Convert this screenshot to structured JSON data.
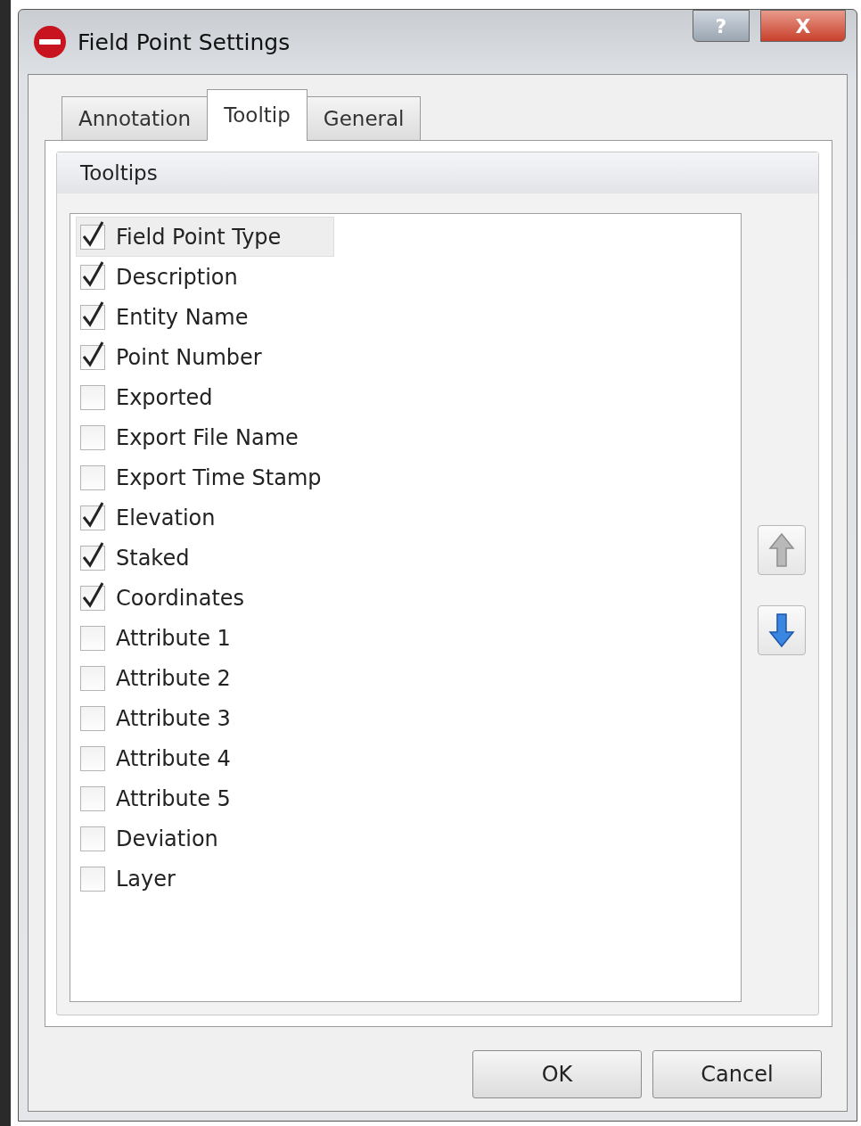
{
  "window": {
    "title": "Field Point Settings",
    "help": "?",
    "close": "X"
  },
  "tabs": [
    {
      "label": "Annotation",
      "selected": false
    },
    {
      "label": "Tooltip",
      "selected": true
    },
    {
      "label": "General",
      "selected": false
    }
  ],
  "group": {
    "title": "Tooltips"
  },
  "items": [
    {
      "label": "Field Point Type",
      "checked": true,
      "selected": true
    },
    {
      "label": "Description",
      "checked": true,
      "selected": false
    },
    {
      "label": "Entity Name",
      "checked": true,
      "selected": false
    },
    {
      "label": "Point Number",
      "checked": true,
      "selected": false
    },
    {
      "label": "Exported",
      "checked": false,
      "selected": false
    },
    {
      "label": "Export File Name",
      "checked": false,
      "selected": false
    },
    {
      "label": "Export Time Stamp",
      "checked": false,
      "selected": false
    },
    {
      "label": "Elevation",
      "checked": true,
      "selected": false
    },
    {
      "label": "Staked",
      "checked": true,
      "selected": false
    },
    {
      "label": "Coordinates",
      "checked": true,
      "selected": false
    },
    {
      "label": "Attribute 1",
      "checked": false,
      "selected": false
    },
    {
      "label": "Attribute 2",
      "checked": false,
      "selected": false
    },
    {
      "label": "Attribute 3",
      "checked": false,
      "selected": false
    },
    {
      "label": "Attribute 4",
      "checked": false,
      "selected": false
    },
    {
      "label": "Attribute 5",
      "checked": false,
      "selected": false
    },
    {
      "label": "Deviation",
      "checked": false,
      "selected": false
    },
    {
      "label": "Layer",
      "checked": false,
      "selected": false
    }
  ],
  "move_buttons": [
    {
      "kind": "up",
      "disabled": true
    },
    {
      "kind": "down",
      "disabled": false
    }
  ],
  "buttons": [
    "OK",
    "Cancel"
  ]
}
